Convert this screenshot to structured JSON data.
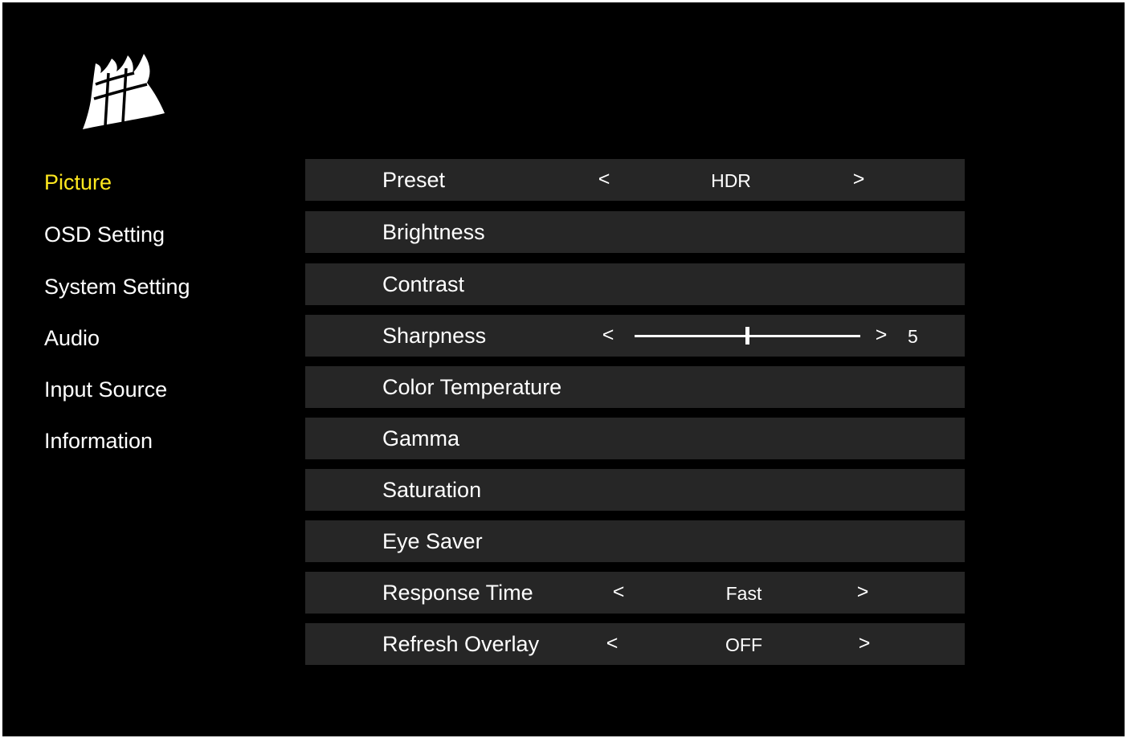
{
  "brand": {
    "logo_icon": "corsair-sails-icon",
    "color": "#ffffff"
  },
  "colors": {
    "active": "#ffe81f",
    "text": "#ffffff",
    "row_bg": "#262626",
    "background": "#000000"
  },
  "side_menu": {
    "items": [
      {
        "label": "Picture",
        "active": true
      },
      {
        "label": "OSD Setting"
      },
      {
        "label": "System Setting"
      },
      {
        "label": "Audio"
      },
      {
        "label": "Input Source"
      },
      {
        "label": "Information"
      }
    ]
  },
  "picture": {
    "rows": [
      {
        "label": "Preset",
        "prev": "<",
        "value": "HDR",
        "next": ">"
      },
      {
        "label": "Brightness"
      },
      {
        "label": "Contrast"
      },
      {
        "label": "Sharpness",
        "prev": "<",
        "next": ">",
        "value": "5",
        "slider_fraction": 0.5
      },
      {
        "label": "Color Temperature"
      },
      {
        "label": "Gamma"
      },
      {
        "label": "Saturation"
      },
      {
        "label": "Eye Saver"
      },
      {
        "label": "Response Time",
        "prev": "<",
        "value": "Fast",
        "next": ">"
      },
      {
        "label": "Refresh Overlay",
        "prev": "<",
        "value": "OFF",
        "next": ">"
      }
    ]
  }
}
